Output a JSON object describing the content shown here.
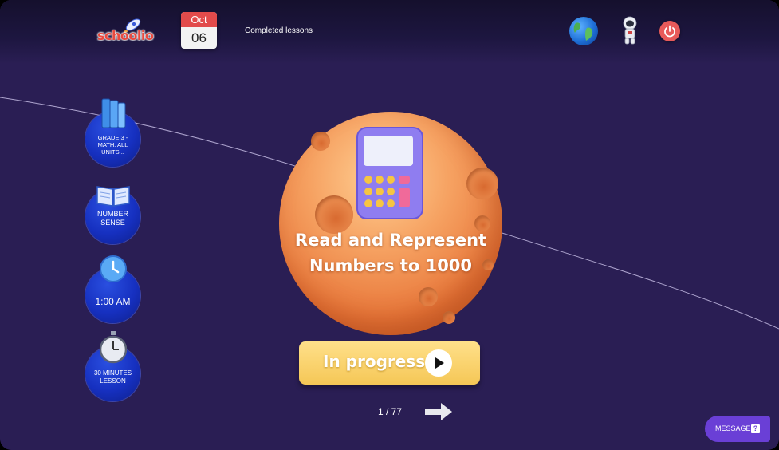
{
  "header": {
    "logo_text": "schoolio",
    "calendar": {
      "month": "Oct",
      "day": "06"
    },
    "completed_link": "Completed lessons"
  },
  "sidebar": {
    "items": [
      {
        "label": "GRADE 3 - MATH: ALL UNITS...",
        "icon": "books-icon"
      },
      {
        "label": "NUMBER SENSE",
        "icon": "open-book-icon"
      },
      {
        "label": "1:00 AM",
        "icon": "clock-icon"
      },
      {
        "label": "30 MINUTES LESSON",
        "icon": "stopwatch-icon"
      }
    ]
  },
  "lesson": {
    "title_line1": "Read and Represent",
    "title_line2": "Numbers to 1000",
    "status_button": "In progress",
    "pager": "1 / 77"
  },
  "message_button": "MESSAGE",
  "colors": {
    "background": "#2a1e54",
    "sidebar_circle": "#1630c0",
    "progress_button": "#f5c756",
    "message_button": "#6a3fd6",
    "power_button": "#e85a5a"
  }
}
